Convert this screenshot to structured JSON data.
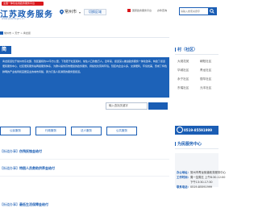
{
  "header": {
    "badge": "全国一体化在线政务服务平台",
    "title": "江苏政务服务",
    "subtitle": "www.jszwfw.gov.cn",
    "location": "常州市",
    "switch_label": "切换区域",
    "links": [
      "国家政务服务平台",
      "办件查询",
      "政务公开",
      "无障碍"
    ],
    "search_placeholder": "请输入搜索关键字"
  },
  "breadcrumb": {
    "text": "常州市 > 天宁 > 青龙街"
  },
  "intro": {
    "heading": "简",
    "body": "青龙街道位于常州市东北部，辖区面积约12平方公里，下辖若干社区和村，常住人口约数万人。近年来，街道深入推进政务服务一体化改革，构建了街道便民服务中心、社区便民服务站两级服务体系，为群众提供高效便捷的政务服务，持续优化营商环境。辖区内企业众多，交通便利，环境优美，形成了特色鲜明的产业格局和宜居宜业的城市风貌，努力打造人民满意的服务型街道。"
  },
  "service_search": {
    "placeholder": "输入查找关键字"
  },
  "category_tabs": [
    "公民服务",
    "行政服务",
    "法人服务",
    "公共服务"
  ],
  "service_items": [
    {
      "tag": "【街道办事】",
      "name": "伤残抚恤金给付"
    },
    {
      "tag": "【街道办事】",
      "name": "特困人员救助供养金给付"
    },
    {
      "tag": "【街道办事】",
      "name": "最低生活保障金给付"
    }
  ],
  "sidebar": {
    "villages_title": "村（社区）",
    "villages": [
      "大观花苑",
      "朝阳社区",
      "华城社区",
      "青龙社区",
      "永宁社区",
      "丽华社区",
      "东瑞社区",
      "元丰社区"
    ],
    "hotline": "0519-85591999",
    "center_title": "为民服务中心",
    "center_name_label": "办公地址：",
    "center_name_value": "常州市青龙街道政务服务中心",
    "hours_label": "工作时间：",
    "hours_value": "周一至周五 上午8:30-12:00",
    "hours_value2": "下午13:30-17:30",
    "phone_label": "联系电话：",
    "phone_value": "0519-85591999"
  },
  "colors": {
    "brand_blue": "#1a5db4",
    "accent_red": "#d9171c"
  }
}
